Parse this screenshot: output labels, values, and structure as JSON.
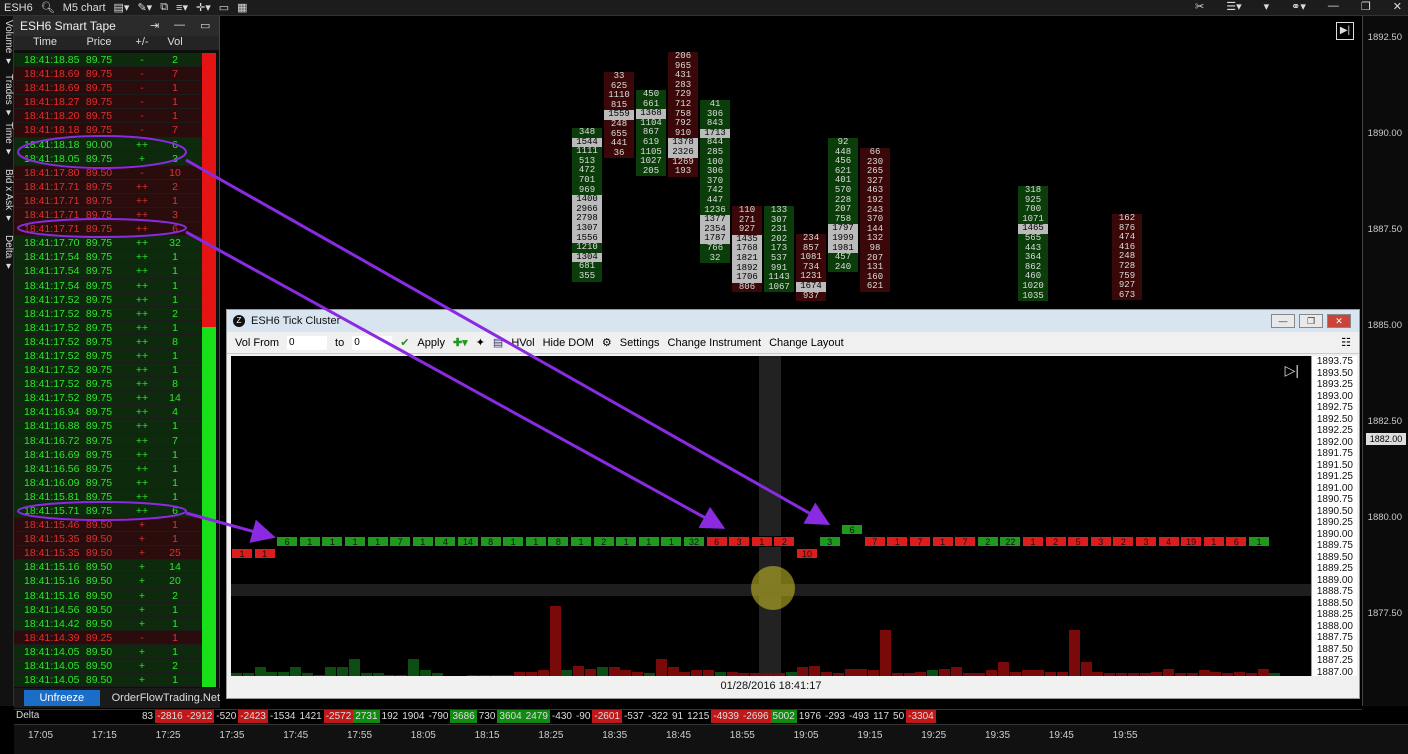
{
  "topbar": {
    "symbol": "ESH6",
    "chart_type": "M5 chart"
  },
  "vertical_tabs": [
    "Volume ▾",
    "Trades ▾",
    "Time ▾",
    "Bid x Ask ▾",
    "Delta ▾"
  ],
  "smart_tape": {
    "title": "ESH6 Smart Tape",
    "columns": [
      "Time",
      "Price",
      "+/-",
      "Vol"
    ],
    "rows": [
      {
        "t": "18:41:18.85",
        "p": "89.75",
        "pm": "-",
        "v": "2",
        "c": "g"
      },
      {
        "t": "18:41:18.69",
        "p": "89.75",
        "pm": "-",
        "v": "7",
        "c": "r"
      },
      {
        "t": "18:41:18.69",
        "p": "89.75",
        "pm": "-",
        "v": "1",
        "c": "r"
      },
      {
        "t": "18:41:18.27",
        "p": "89.75",
        "pm": "-",
        "v": "1",
        "c": "r"
      },
      {
        "t": "18:41:18.20",
        "p": "89.75",
        "pm": "-",
        "v": "1",
        "c": "r"
      },
      {
        "t": "18:41:18.18",
        "p": "89.75",
        "pm": "-",
        "v": "7",
        "c": "r"
      },
      {
        "t": "18:41:18.18",
        "p": "90.00",
        "pm": "++",
        "v": "6",
        "c": "g"
      },
      {
        "t": "18:41:18.05",
        "p": "89.75",
        "pm": "+",
        "v": "3",
        "c": "g"
      },
      {
        "t": "18:41:17.80",
        "p": "89.50",
        "pm": "-",
        "v": "10",
        "c": "r"
      },
      {
        "t": "18:41:17.71",
        "p": "89.75",
        "pm": "++",
        "v": "2",
        "c": "r"
      },
      {
        "t": "18:41:17.71",
        "p": "89.75",
        "pm": "++",
        "v": "1",
        "c": "r"
      },
      {
        "t": "18:41:17.71",
        "p": "89.75",
        "pm": "++",
        "v": "3",
        "c": "r"
      },
      {
        "t": "18:41:17.71",
        "p": "89.75",
        "pm": "++",
        "v": "6",
        "c": "r"
      },
      {
        "t": "18:41:17.70",
        "p": "89.75",
        "pm": "++",
        "v": "32",
        "c": "g"
      },
      {
        "t": "18:41:17.54",
        "p": "89.75",
        "pm": "++",
        "v": "1",
        "c": "g"
      },
      {
        "t": "18:41:17.54",
        "p": "89.75",
        "pm": "++",
        "v": "1",
        "c": "g"
      },
      {
        "t": "18:41:17.54",
        "p": "89.75",
        "pm": "++",
        "v": "1",
        "c": "g"
      },
      {
        "t": "18:41:17.52",
        "p": "89.75",
        "pm": "++",
        "v": "1",
        "c": "g"
      },
      {
        "t": "18:41:17.52",
        "p": "89.75",
        "pm": "++",
        "v": "2",
        "c": "g"
      },
      {
        "t": "18:41:17.52",
        "p": "89.75",
        "pm": "++",
        "v": "1",
        "c": "g"
      },
      {
        "t": "18:41:17.52",
        "p": "89.75",
        "pm": "++",
        "v": "8",
        "c": "g"
      },
      {
        "t": "18:41:17.52",
        "p": "89.75",
        "pm": "++",
        "v": "1",
        "c": "g"
      },
      {
        "t": "18:41:17.52",
        "p": "89.75",
        "pm": "++",
        "v": "1",
        "c": "g"
      },
      {
        "t": "18:41:17.52",
        "p": "89.75",
        "pm": "++",
        "v": "8",
        "c": "g"
      },
      {
        "t": "18:41:17.52",
        "p": "89.75",
        "pm": "++",
        "v": "14",
        "c": "g"
      },
      {
        "t": "18:41:16.94",
        "p": "89.75",
        "pm": "++",
        "v": "4",
        "c": "g"
      },
      {
        "t": "18:41:16.88",
        "p": "89.75",
        "pm": "++",
        "v": "1",
        "c": "g"
      },
      {
        "t": "18:41:16.72",
        "p": "89.75",
        "pm": "++",
        "v": "7",
        "c": "g"
      },
      {
        "t": "18:41:16.69",
        "p": "89.75",
        "pm": "++",
        "v": "1",
        "c": "g"
      },
      {
        "t": "18:41:16.56",
        "p": "89.75",
        "pm": "++",
        "v": "1",
        "c": "g"
      },
      {
        "t": "18:41:16.09",
        "p": "89.75",
        "pm": "++",
        "v": "1",
        "c": "g"
      },
      {
        "t": "18:41:15.81",
        "p": "89.75",
        "pm": "++",
        "v": "1",
        "c": "g"
      },
      {
        "t": "18:41:15.71",
        "p": "89.75",
        "pm": "++",
        "v": "6",
        "c": "g"
      },
      {
        "t": "18:41:15.46",
        "p": "89.50",
        "pm": "+",
        "v": "1",
        "c": "r"
      },
      {
        "t": "18:41:15.35",
        "p": "89.50",
        "pm": "+",
        "v": "1",
        "c": "r"
      },
      {
        "t": "18:41:15.35",
        "p": "89.50",
        "pm": "+",
        "v": "25",
        "c": "r"
      },
      {
        "t": "18:41:15.16",
        "p": "89.50",
        "pm": "+",
        "v": "14",
        "c": "g"
      },
      {
        "t": "18:41:15.16",
        "p": "89.50",
        "pm": "+",
        "v": "20",
        "c": "g"
      },
      {
        "t": "18:41:15.16",
        "p": "89.50",
        "pm": "+",
        "v": "2",
        "c": "g"
      },
      {
        "t": "18:41:14.56",
        "p": "89.50",
        "pm": "+",
        "v": "1",
        "c": "g"
      },
      {
        "t": "18:41:14.42",
        "p": "89.50",
        "pm": "+",
        "v": "1",
        "c": "g"
      },
      {
        "t": "18:41:14.39",
        "p": "89.25",
        "pm": "-",
        "v": "1",
        "c": "r"
      },
      {
        "t": "18:41:14.05",
        "p": "89.50",
        "pm": "+",
        "v": "1",
        "c": "g"
      },
      {
        "t": "18:41:14.05",
        "p": "89.50",
        "pm": "+",
        "v": "2",
        "c": "g"
      },
      {
        "t": "18:41:14.05",
        "p": "89.50",
        "pm": "+",
        "v": "1",
        "c": "g"
      }
    ],
    "unfreeze_label": "Unfreeze",
    "footer_text": "OrderFlowTrading.Net"
  },
  "main_chart": {
    "price_ticks": [
      "1892.50",
      "1890.00",
      "1887.50",
      "1885.00",
      "1882.50",
      "1880.00",
      "1877.50"
    ],
    "current_price": "1882.00",
    "footprint": [
      [
        "348",
        "1544",
        "1111",
        "513",
        "472",
        "701",
        "969",
        "1400",
        "2966",
        "2798",
        "1307",
        "1556",
        "1210",
        "1304",
        "681",
        "355"
      ],
      [
        "33",
        "625",
        "1110",
        "815",
        "1559",
        "248",
        "655",
        "441",
        "36"
      ],
      [
        "450",
        "661",
        "1368",
        "1104",
        "867",
        "619",
        "1105",
        "1027",
        "205"
      ],
      [
        "206",
        "965",
        "431",
        "283",
        "729",
        "712",
        "758",
        "792",
        "910",
        "1378",
        "2326",
        "1269",
        "193"
      ],
      [
        "41",
        "306",
        "843",
        "1713",
        "844",
        "285",
        "100",
        "306",
        "370",
        "742",
        "447",
        "1236",
        "1377",
        "2354",
        "1787",
        "766",
        "32"
      ],
      [
        "110",
        "271",
        "927",
        "1435",
        "1768",
        "1821",
        "1892",
        "1706",
        "806"
      ],
      [
        "133",
        "307",
        "231",
        "202",
        "173",
        "537",
        "991",
        "1143",
        "1067"
      ],
      [
        "234",
        "857",
        "1081",
        "734",
        "1231",
        "1674",
        "937"
      ],
      [
        "92",
        "448",
        "456",
        "621",
        "401",
        "570",
        "228",
        "207",
        "758",
        "1797",
        "1999",
        "1981",
        "457",
        "240"
      ],
      [
        "66",
        "230",
        "265",
        "327",
        "463",
        "192",
        "243",
        "370",
        "144",
        "132",
        "98",
        "207",
        "131",
        "160",
        "621"
      ],
      [
        "318",
        "925",
        "700",
        "1071",
        "1465",
        "565",
        "443",
        "364",
        "862",
        "460",
        "1020",
        "1035"
      ],
      [
        "162",
        "876",
        "474",
        "416",
        "248",
        "728",
        "759",
        "927",
        "673"
      ]
    ],
    "delta_label": "Delta",
    "delta_values": [
      "83",
      "-2816",
      "-2912",
      "-520",
      "-2423",
      "-1534",
      "1421",
      "-2572",
      "2731",
      "192",
      "1904",
      "-790",
      "3686",
      "730",
      "3604",
      "2479",
      "-430",
      "-90",
      "-2601",
      "-537",
      "-322",
      "91",
      "1215",
      "-4939",
      "-2696",
      "5002",
      "1976",
      "-293",
      "-493",
      "117",
      "50",
      "-3304"
    ],
    "time_ticks": [
      "17:05",
      "17:15",
      "17:25",
      "17:35",
      "17:45",
      "17:55",
      "18:05",
      "18:15",
      "18:25",
      "18:35",
      "18:45",
      "18:55",
      "19:05",
      "19:15",
      "19:25",
      "19:35",
      "19:45",
      "19:55"
    ]
  },
  "tick_cluster": {
    "title": "ESH6 Tick Cluster",
    "vol_from_label": "Vol From",
    "vol_from_value": "0",
    "to_label": "to",
    "to_value": "0",
    "apply_label": "Apply",
    "hvol_label": "HVol",
    "hide_dom_label": "Hide DOM",
    "settings_label": "Settings",
    "change_instrument_label": "Change Instrument",
    "change_layout_label": "Change Layout",
    "timestamp": "01/28/2016 18:41:17",
    "price_ticks": [
      "1893.75",
      "1893.50",
      "1893.25",
      "1893.00",
      "1892.75",
      "1892.50",
      "1892.25",
      "1892.00",
      "1891.75",
      "1891.50",
      "1891.25",
      "1891.00",
      "1890.75",
      "1890.50",
      "1890.25",
      "1890.00",
      "1889.75",
      "1889.50",
      "1889.25",
      "1889.00",
      "1888.75",
      "1888.50",
      "1888.25",
      "1888.00",
      "1887.75",
      "1887.50",
      "1887.25",
      "1887.00"
    ],
    "ticks": [
      {
        "v": "1",
        "c": "r",
        "lvl": 0
      },
      {
        "v": "1",
        "c": "r",
        "lvl": 0
      },
      {
        "v": "6",
        "c": "g",
        "lvl": 1
      },
      {
        "v": "1",
        "c": "g",
        "lvl": 1
      },
      {
        "v": "1",
        "c": "g",
        "lvl": 1
      },
      {
        "v": "1",
        "c": "g",
        "lvl": 1
      },
      {
        "v": "1",
        "c": "g",
        "lvl": 1
      },
      {
        "v": "7",
        "c": "g",
        "lvl": 1
      },
      {
        "v": "1",
        "c": "g",
        "lvl": 1
      },
      {
        "v": "4",
        "c": "g",
        "lvl": 1
      },
      {
        "v": "14",
        "c": "g",
        "lvl": 1
      },
      {
        "v": "8",
        "c": "g",
        "lvl": 1
      },
      {
        "v": "1",
        "c": "g",
        "lvl": 1
      },
      {
        "v": "1",
        "c": "g",
        "lvl": 1
      },
      {
        "v": "8",
        "c": "g",
        "lvl": 1
      },
      {
        "v": "1",
        "c": "g",
        "lvl": 1
      },
      {
        "v": "2",
        "c": "g",
        "lvl": 1
      },
      {
        "v": "1",
        "c": "g",
        "lvl": 1
      },
      {
        "v": "1",
        "c": "g",
        "lvl": 1
      },
      {
        "v": "1",
        "c": "g",
        "lvl": 1
      },
      {
        "v": "32",
        "c": "g",
        "lvl": 1
      },
      {
        "v": "6",
        "c": "r",
        "lvl": 1
      },
      {
        "v": "3",
        "c": "r",
        "lvl": 1
      },
      {
        "v": "1",
        "c": "r",
        "lvl": 1
      },
      {
        "v": "2",
        "c": "r",
        "lvl": 1
      },
      {
        "v": "10",
        "c": "r",
        "lvl": 0
      },
      {
        "v": "3",
        "c": "g",
        "lvl": 1
      },
      {
        "v": "6",
        "c": "g",
        "lvl": 2
      },
      {
        "v": "7",
        "c": "r",
        "lvl": 1
      },
      {
        "v": "1",
        "c": "r",
        "lvl": 1
      },
      {
        "v": "7",
        "c": "r",
        "lvl": 1
      },
      {
        "v": "1",
        "c": "r",
        "lvl": 1
      },
      {
        "v": "7",
        "c": "r",
        "lvl": 1
      },
      {
        "v": "2",
        "c": "g",
        "lvl": 1
      },
      {
        "v": "22",
        "c": "g",
        "lvl": 1
      },
      {
        "v": "1",
        "c": "r",
        "lvl": 1
      },
      {
        "v": "2",
        "c": "r",
        "lvl": 1
      },
      {
        "v": "5",
        "c": "r",
        "lvl": 1
      },
      {
        "v": "3",
        "c": "r",
        "lvl": 1
      },
      {
        "v": "2",
        "c": "r",
        "lvl": 1
      },
      {
        "v": "3",
        "c": "r",
        "lvl": 1
      },
      {
        "v": "4",
        "c": "r",
        "lvl": 1
      },
      {
        "v": "19",
        "c": "r",
        "lvl": 1
      },
      {
        "v": "1",
        "c": "r",
        "lvl": 1
      },
      {
        "v": "6",
        "c": "r",
        "lvl": 1
      },
      {
        "v": "1",
        "c": "g",
        "lvl": 1
      }
    ],
    "volume_bars": [
      2,
      2,
      6,
      3,
      3,
      6,
      2,
      0.5,
      6,
      6,
      12,
      2,
      2,
      1,
      0.5,
      12,
      4,
      2,
      0.2,
      0.3,
      0.5,
      0.5,
      0.6,
      1,
      3,
      3,
      4,
      48,
      4,
      7,
      5,
      6,
      6,
      4,
      3,
      2,
      12,
      6,
      3,
      4,
      4,
      3,
      3,
      2,
      2,
      2,
      2,
      3,
      6,
      7,
      3,
      2,
      5,
      5,
      4,
      32,
      2,
      2,
      3,
      4,
      5,
      6,
      2,
      2,
      4,
      10,
      3,
      4,
      4,
      3,
      3,
      32,
      10,
      3,
      2,
      2,
      2,
      2,
      3,
      5,
      2,
      2,
      4,
      3,
      2,
      3,
      2,
      5,
      2
    ],
    "volume_colors": "gggggggggggggggggggrrrrrrrrrgrrgrrrgrrrrrgrrrrrgrrrrrrrrrrrgrrrrrrrrrrrrrrrrrrrrrrrrrrrr"
  },
  "colors": {
    "buy": "#1f9a1f",
    "sell": "#dd1c1c",
    "annotation": "#8a2be2"
  }
}
